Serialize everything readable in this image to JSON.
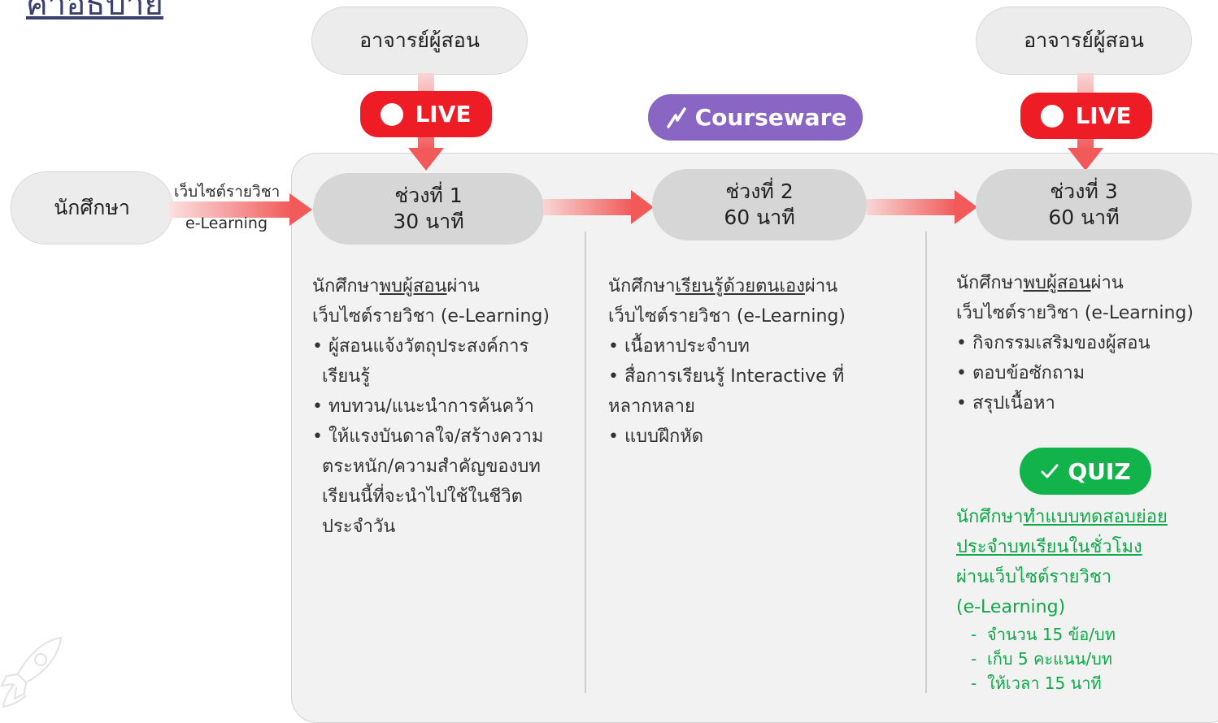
{
  "heading_partial": "คำอธิบาย",
  "student": {
    "label": "นักศึกษา"
  },
  "link_label": {
    "line1": "เว็บไซต์รายวิชา",
    "line2": "e-Learning"
  },
  "teacher1": {
    "label": "อาจารย์ผู้สอน"
  },
  "teacher3": {
    "label": "อาจารย์ผู้สอน"
  },
  "badges": {
    "live1": "LIVE",
    "courseware": "Courseware",
    "courseware_icon": "lightning-icon",
    "live3": "LIVE",
    "quiz": "QUIZ",
    "quiz_icon": "check-icon"
  },
  "sessions": [
    {
      "title": "ช่วงที่ 1",
      "duration": "30 นาที"
    },
    {
      "title": "ช่วงที่ 2",
      "duration": "60 นาที"
    },
    {
      "title": "ช่วงที่ 3",
      "duration": "60 นาที"
    }
  ],
  "col1": {
    "intro_pre": "นักศึกษา",
    "intro_u": "พบผู้สอน",
    "intro_post": "ผ่าน",
    "intro_line2": "เว็บไซต์รายวิชา (e-Learning)",
    "bullets": [
      "ผู้สอนแจ้งวัตถุประสงค์การเรียนรู้",
      "ทบทวน/แนะนำการค้นคว้า",
      "ให้แรงบันดาลใจ/สร้างความตระหนัก/ความสำคัญของบทเรียนนี้ที่จะนำไปใช้ในชีวิตประจำวัน"
    ]
  },
  "col2": {
    "intro_pre": "นักศึกษา",
    "intro_u": "เรียนรู้ด้วยตนเอง",
    "intro_post": "ผ่าน",
    "intro_line2": "เว็บไซต์รายวิชา (e-Learning)",
    "bullets": [
      "เนื้อหาประจำบท",
      "สื่อการเรียนรู้ Interactive ที่หลากหลาย",
      "แบบฝึกหัด"
    ]
  },
  "col3": {
    "intro_pre": "นักศึกษา",
    "intro_u": "พบผู้สอน",
    "intro_post": "ผ่าน",
    "intro_line2": "เว็บไซต์รายวิชา (e-Learning)",
    "bullets": [
      "กิจกรรมเสริมของผู้สอน",
      "ตอบข้อซักถาม",
      "สรุปเนื้อหา"
    ],
    "quiz_pre": "นักศึกษา",
    "quiz_u1": "ทำแบบทดสอบย่อย",
    "quiz_u2": "ประจำบทเรียนในชั่วโมง",
    "quiz_line3": "ผ่านเว็บไซต์รายวิชา",
    "quiz_line4": "(e-Learning)",
    "quiz_items": [
      "จำนวน 15 ข้อ/บท",
      "เก็บ 5 คะแนน/บท",
      "ให้เวลา 15 นาที"
    ]
  },
  "colors": {
    "live": "#ee1c24",
    "courseware": "#8965c4",
    "quiz": "#12b34b",
    "arrow": "#f25a5a"
  }
}
